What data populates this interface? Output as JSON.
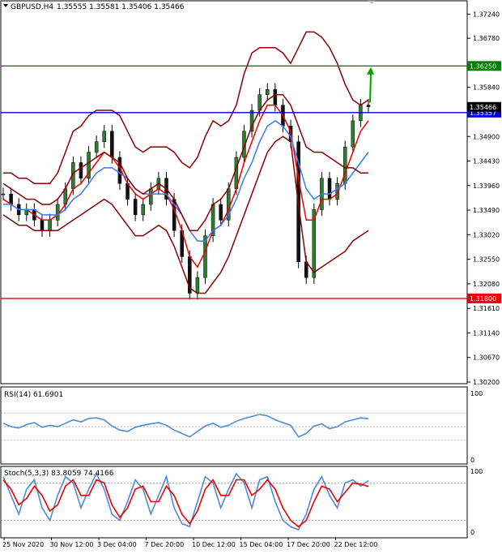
{
  "window": {
    "title": "GBPUSD,H4",
    "ohlc": "1.35555 1.35581 1.35406 1.35466"
  },
  "chart_data": [
    {
      "type": "line",
      "panel": "price",
      "y_ticks": [
        1.3724,
        1.3678,
        1.3584,
        1.349,
        1.3443,
        1.3396,
        1.3349,
        1.3302,
        1.3255,
        1.3208,
        1.3161,
        1.3114,
        1.3067,
        1.302
      ],
      "y_tick_labels": [
        "1.37240",
        "1.36780",
        "1.35840",
        "1.34900",
        "1.34430",
        "1.33960",
        "1.33490",
        "1.33020",
        "1.32550",
        "1.32080",
        "1.31610",
        "1.31140",
        "1.30670",
        "1.30200"
      ],
      "ylim": [
        1.302,
        1.3745
      ],
      "x_tick_labels": [
        "25 Nov 2020",
        "30 Nov 12:00",
        "3 Dec 04:00",
        "7 Dec 20:00",
        "10 Dec 12:00",
        "15 Dec 04:00",
        "17 Dec 20:00",
        "22 Dec 12:00"
      ],
      "levels": [
        {
          "value": 1.3625,
          "label": "1.36250",
          "color": "#008000"
        },
        {
          "value": 1.35357,
          "label": "1.35357",
          "color": "#0000cc"
        },
        {
          "value": 1.318,
          "label": "1.31800",
          "color": "#ee0000"
        }
      ],
      "current_price": {
        "value": 1.35466,
        "label": "1.35466"
      },
      "series": [
        {
          "color": "#333333",
          "values": [
            1.338,
            1.336,
            1.334,
            1.335,
            1.333,
            1.331,
            1.333,
            1.336,
            1.339,
            1.344,
            1.341,
            1.346,
            1.348,
            1.35,
            1.345,
            1.34,
            1.337,
            1.334,
            1.336,
            1.339,
            1.341,
            1.337,
            1.331,
            1.326,
            1.319,
            1.322,
            1.33,
            1.336,
            1.333,
            1.339,
            1.345,
            1.35,
            1.354,
            1.357,
            1.358,
            1.355,
            1.351,
            1.348,
            1.325,
            1.322,
            1.335,
            1.341,
            1.337,
            1.34,
            1.347,
            1.352,
            1.355,
            1.3547
          ]
        },
        {
          "color": "#ee0000",
          "values": [
            1.337,
            1.336,
            1.335,
            1.335,
            1.334,
            1.333,
            1.333,
            1.334,
            1.336,
            1.339,
            1.34,
            1.342,
            1.344,
            1.346,
            1.345,
            1.343,
            1.34,
            1.338,
            1.337,
            1.338,
            1.339,
            1.338,
            1.335,
            1.331,
            1.326,
            1.324,
            1.327,
            1.331,
            1.332,
            1.335,
            1.339,
            1.344,
            1.348,
            1.352,
            1.355,
            1.355,
            1.353,
            1.35,
            1.341,
            1.333,
            1.333,
            1.337,
            1.337,
            1.338,
            1.342,
            1.346,
            1.35,
            1.352
          ]
        },
        {
          "color": "#3a78ff",
          "values": [
            1.336,
            1.336,
            1.335,
            1.335,
            1.335,
            1.334,
            1.334,
            1.334,
            1.335,
            1.337,
            1.338,
            1.34,
            1.342,
            1.343,
            1.343,
            1.342,
            1.341,
            1.339,
            1.338,
            1.338,
            1.338,
            1.338,
            1.336,
            1.334,
            1.331,
            1.329,
            1.329,
            1.331,
            1.332,
            1.334,
            1.337,
            1.341,
            1.344,
            1.348,
            1.351,
            1.352,
            1.351,
            1.349,
            1.344,
            1.339,
            1.337,
            1.338,
            1.338,
            1.339,
            1.34,
            1.342,
            1.344,
            1.346
          ]
        },
        {
          "color": "#8b0000",
          "values": [
            1.342,
            1.342,
            1.341,
            1.341,
            1.34,
            1.34,
            1.34,
            1.342,
            1.346,
            1.35,
            1.351,
            1.353,
            1.354,
            1.354,
            1.354,
            1.353,
            1.35,
            1.347,
            1.346,
            1.347,
            1.347,
            1.347,
            1.346,
            1.344,
            1.343,
            1.345,
            1.349,
            1.352,
            1.351,
            1.352,
            1.355,
            1.361,
            1.365,
            1.366,
            1.366,
            1.366,
            1.365,
            1.363,
            1.366,
            1.369,
            1.369,
            1.368,
            1.366,
            1.363,
            1.359,
            1.356,
            1.355,
            1.356
          ]
        },
        {
          "color": "#8b0000",
          "values": [
            1.334,
            1.333,
            1.332,
            1.332,
            1.331,
            1.331,
            1.331,
            1.331,
            1.332,
            1.333,
            1.334,
            1.335,
            1.336,
            1.337,
            1.336,
            1.334,
            1.332,
            1.33,
            1.33,
            1.331,
            1.332,
            1.331,
            1.328,
            1.324,
            1.32,
            1.319,
            1.319,
            1.321,
            1.323,
            1.326,
            1.33,
            1.334,
            1.338,
            1.342,
            1.346,
            1.348,
            1.349,
            1.348,
            1.336,
            1.325,
            1.323,
            1.324,
            1.325,
            1.326,
            1.327,
            1.329,
            1.33,
            1.331
          ]
        },
        {
          "color": "#8b0000",
          "values": [
            1.34,
            1.339,
            1.338,
            1.337,
            1.337,
            1.336,
            1.336,
            1.337,
            1.339,
            1.342,
            1.343,
            1.344,
            1.345,
            1.346,
            1.345,
            1.344,
            1.341,
            1.339,
            1.338,
            1.339,
            1.34,
            1.339,
            1.337,
            1.334,
            1.331,
            1.331,
            1.333,
            1.336,
            1.337,
            1.339,
            1.343,
            1.347,
            1.351,
            1.354,
            1.356,
            1.357,
            1.357,
            1.355,
            1.351,
            1.347,
            1.346,
            1.346,
            1.345,
            1.344,
            1.343,
            1.343,
            1.342,
            1.342
          ]
        }
      ]
    },
    {
      "type": "line",
      "panel": "rsi",
      "label": "RSI(14) 61.6901",
      "ylim": [
        0,
        100
      ],
      "y_tick_labels": [
        "100",
        "0"
      ],
      "levels": [
        70,
        50,
        30
      ],
      "series": [
        {
          "color": "#4a8bdf",
          "values": [
            55,
            50,
            48,
            53,
            56,
            49,
            52,
            50,
            55,
            60,
            57,
            62,
            63,
            60,
            51,
            45,
            43,
            49,
            52,
            54,
            56,
            52,
            45,
            40,
            35,
            43,
            51,
            55,
            49,
            52,
            58,
            62,
            65,
            68,
            66,
            60,
            56,
            52,
            35,
            40,
            51,
            54,
            47,
            50,
            57,
            60,
            63,
            61.69
          ]
        }
      ]
    },
    {
      "type": "line",
      "panel": "stochastic",
      "label": "Stoch(5,3,3) 83.8059 74.4166",
      "ylim": [
        0,
        100
      ],
      "y_tick_labels": [
        "100",
        "0"
      ],
      "levels": [
        80,
        20
      ],
      "series": [
        {
          "color": "#4a8bdf",
          "values": [
            90,
            60,
            30,
            70,
            85,
            40,
            20,
            60,
            90,
            80,
            40,
            70,
            95,
            70,
            30,
            20,
            50,
            85,
            70,
            30,
            60,
            90,
            40,
            15,
            10,
            50,
            90,
            80,
            40,
            70,
            95,
            80,
            40,
            85,
            90,
            50,
            20,
            10,
            5,
            30,
            70,
            90,
            60,
            40,
            80,
            85,
            75,
            83.8
          ]
        },
        {
          "color": "#ee0000",
          "values": [
            85,
            70,
            45,
            55,
            75,
            60,
            35,
            45,
            75,
            85,
            60,
            60,
            85,
            80,
            45,
            25,
            40,
            70,
            75,
            50,
            50,
            75,
            60,
            30,
            15,
            35,
            70,
            85,
            60,
            60,
            85,
            85,
            60,
            70,
            85,
            70,
            40,
            20,
            10,
            20,
            50,
            75,
            70,
            50,
            65,
            80,
            78,
            74.4
          ]
        }
      ]
    }
  ]
}
